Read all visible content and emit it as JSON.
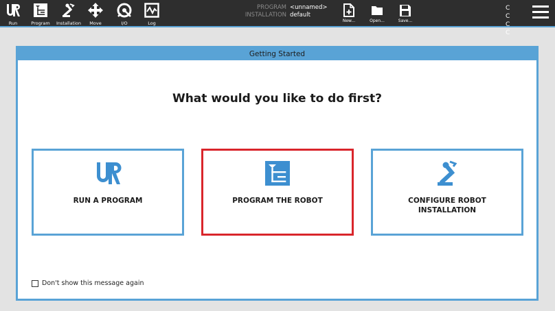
{
  "nav": {
    "run": "Run",
    "program": "Program",
    "installation": "Installation",
    "move": "Move",
    "io": "I/O",
    "log": "Log"
  },
  "header": {
    "program_key": "PROGRAM",
    "program_value": "<unnamed>",
    "installation_key": "INSTALLATION",
    "installation_value": "default"
  },
  "file": {
    "new": "New...",
    "open": "Open...",
    "save": "Save..."
  },
  "speed": {
    "line1": "C C",
    "line2": "C C"
  },
  "dialog": {
    "title": "Getting Started",
    "heading": "What would you like to do first?",
    "options": [
      {
        "label": "RUN A PROGRAM",
        "icon": "ur-logo-icon"
      },
      {
        "label": "PROGRAM THE ROBOT",
        "icon": "program-tree-icon",
        "selected": true
      },
      {
        "label": "CONFIGURE ROBOT INSTALLATION",
        "icon": "robot-arm-icon"
      }
    ],
    "dont_show": "Don't show this message again"
  },
  "colors": {
    "accent": "#59a3d6",
    "topbar": "#2e2e2e",
    "selected_border": "#d9252b",
    "background": "#e3e3e3"
  }
}
